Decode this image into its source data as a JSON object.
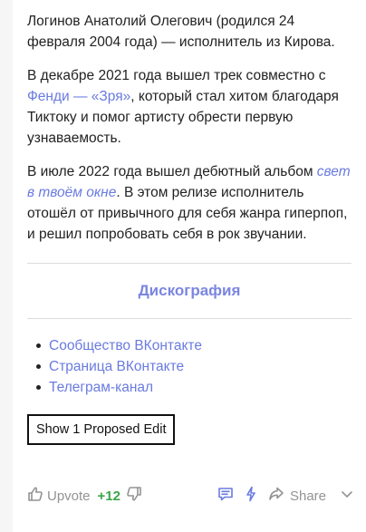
{
  "answer": {
    "paragraph1": "Логинов Анатолий Олегович (родился 24 февраля 2004 года) — исполнитель из Кирова.",
    "paragraph2_pre": "В декабре 2021 года вышел трек совместно с ",
    "paragraph2_link1": "Фенди",
    "paragraph2_dash": " — ",
    "paragraph2_link2": "«Зря»",
    "paragraph2_post": ", который стал хитом благодаря Тиктоку и помог артисту обрести первую узнаваемость.",
    "paragraph3_pre": "В июле 2022 года вышел дебютный альбом ",
    "paragraph3_link": "свет в твоём окне",
    "paragraph3_post": ". В этом релизе исполнитель отошёл от привычного для себя жанра гиперпоп, и решил попробовать себя в рок звучании."
  },
  "section": {
    "title": "Дискография"
  },
  "links": [
    "Сообщество ВКонтакте",
    "Страница ВКонтакте",
    "Телеграм-канал"
  ],
  "proposed_edit_button": "Show 1 Proposed Edit",
  "footer": {
    "upvote_label": "Upvote",
    "upvote_count": "+12",
    "share_label": "Share"
  },
  "colors": {
    "link": "#6a7be0",
    "section_title": "#7b86e0",
    "upvote_count": "#3aa64a",
    "icon_gray": "#939393",
    "icon_blue": "#6a7be0"
  },
  "icons": {
    "upvote": "thumbs-up-icon",
    "downvote": "thumbs-down-icon",
    "comment": "comment-icon",
    "boost": "lightning-icon",
    "share": "share-icon",
    "more": "chevron-down-icon"
  }
}
